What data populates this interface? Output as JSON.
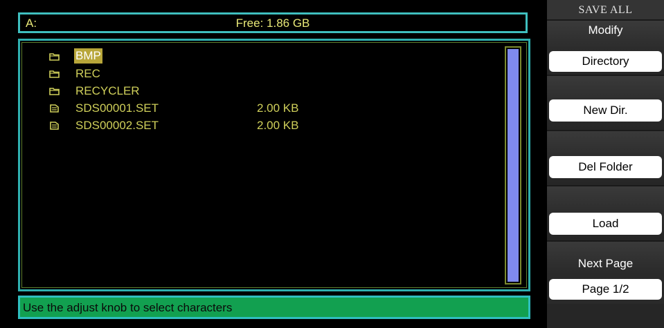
{
  "path_bar": {
    "drive": "A:",
    "free_space": "Free: 1.86 GB"
  },
  "files": [
    {
      "type": "folder",
      "icon": "folder-icon",
      "name": "BMP",
      "size": "",
      "selected": true
    },
    {
      "type": "folder",
      "icon": "folder-icon",
      "name": "REC",
      "size": "",
      "selected": false
    },
    {
      "type": "folder",
      "icon": "folder-icon",
      "name": "RECYCLER",
      "size": "",
      "selected": false
    },
    {
      "type": "file",
      "icon": "file-icon",
      "name": "SDS00001.SET",
      "size": "2.00 KB",
      "selected": false
    },
    {
      "type": "file",
      "icon": "file-icon",
      "name": "SDS00002.SET",
      "size": "2.00 KB",
      "selected": false
    }
  ],
  "status": {
    "message": "Use the adjust knob to select characters"
  },
  "menu": {
    "title": "SAVE ALL",
    "modify_caption": "Modify",
    "modify_value": "Directory",
    "new_dir_label": "New Dir.",
    "del_folder_label": "Del Folder",
    "load_label": "Load",
    "next_page_caption": "Next Page",
    "next_page_value": "Page 1/2"
  },
  "colors": {
    "file_text": "#cfcf5a",
    "selection": "#b8a63a",
    "panel_border": "#2fafaf",
    "status_bg": "#12a050",
    "scroll_thumb": "#7f8aee"
  }
}
